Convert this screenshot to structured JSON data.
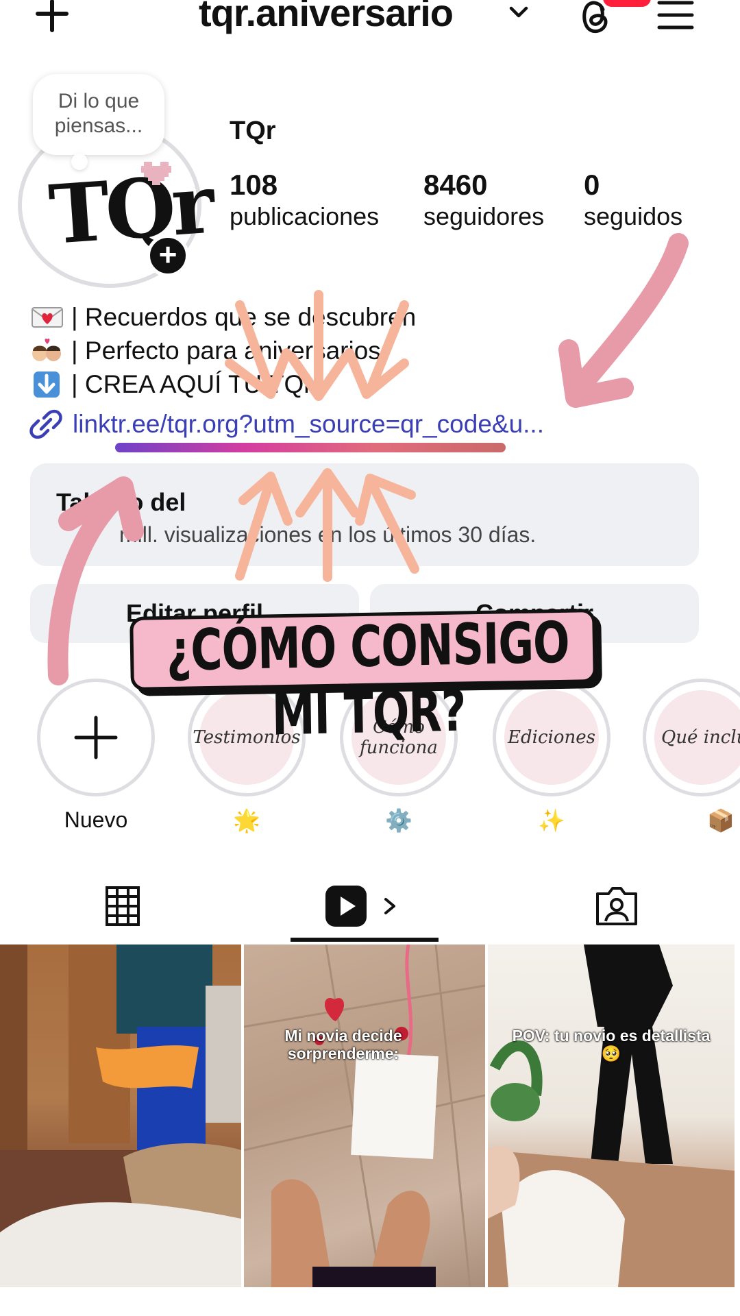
{
  "header": {
    "username": "tqr.aniversario"
  },
  "note": {
    "text": "Di lo que piensas..."
  },
  "profile": {
    "avatar_text": "TQr",
    "display_name": "TQr",
    "stats": [
      {
        "value": "108",
        "label": "publicaciones"
      },
      {
        "value": "8460",
        "label": "seguidores"
      },
      {
        "value": "0",
        "label": "seguidos"
      }
    ]
  },
  "bio": {
    "lines": [
      {
        "icon": "love-letter-emoji",
        "text": "| Recuerdos que se descubren"
      },
      {
        "icon": "kissing-couple-emoji",
        "text": "| Perfecto para aniversarios"
      },
      {
        "icon": "down-arrow-emoji",
        "text": "| CREA AQUÍ TU TQr"
      }
    ],
    "link": "linktr.ee/tqr.org?utm_source=qr_code&u..."
  },
  "dashboard": {
    "title": "Tablero del",
    "subtitle": "mill. visualizaciones en los últimos 30 días."
  },
  "buttons": {
    "edit": "Editar perfil",
    "share": "Compartir"
  },
  "overlay": {
    "title": "¿CÓMO CONSIGO MI TQR?"
  },
  "highlights": [
    {
      "cover": "",
      "label": "Nuevo"
    },
    {
      "cover": "Testimonios",
      "label": "🌟"
    },
    {
      "cover": "Cómo funciona",
      "label": "⚙️"
    },
    {
      "cover": "Ediciones",
      "label": "✨"
    },
    {
      "cover": "Qué inclu",
      "label": "📦"
    }
  ],
  "posts": [
    {
      "caption": ""
    },
    {
      "caption": "Mi novia decide sorprenderme:"
    },
    {
      "caption": "POV: tu novio es detallista 🥺"
    }
  ],
  "colors": {
    "accent_pink": "#f6b9cb",
    "link_blue": "#3b3fb6",
    "arrow_pink": "#e79aa8",
    "arrow_peach": "#f6b49a",
    "badge_red": "#ff1f3d"
  }
}
